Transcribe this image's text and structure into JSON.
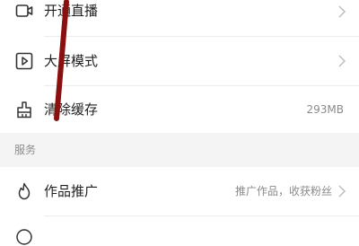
{
  "menu": {
    "items": [
      {
        "label": "开通直播",
        "icon": "video-camera-icon"
      },
      {
        "label": "大屏模式",
        "icon": "play-screen-icon"
      },
      {
        "label": "清除缓存",
        "icon": "broom-icon",
        "value": "293MB"
      }
    ]
  },
  "section": {
    "title": "服务"
  },
  "services": {
    "items": [
      {
        "label": "作品推广",
        "icon": "flame-icon",
        "value": "推广作品，收获粉丝"
      }
    ]
  },
  "colors": {
    "annotation_stroke": "#8b0f0f"
  }
}
